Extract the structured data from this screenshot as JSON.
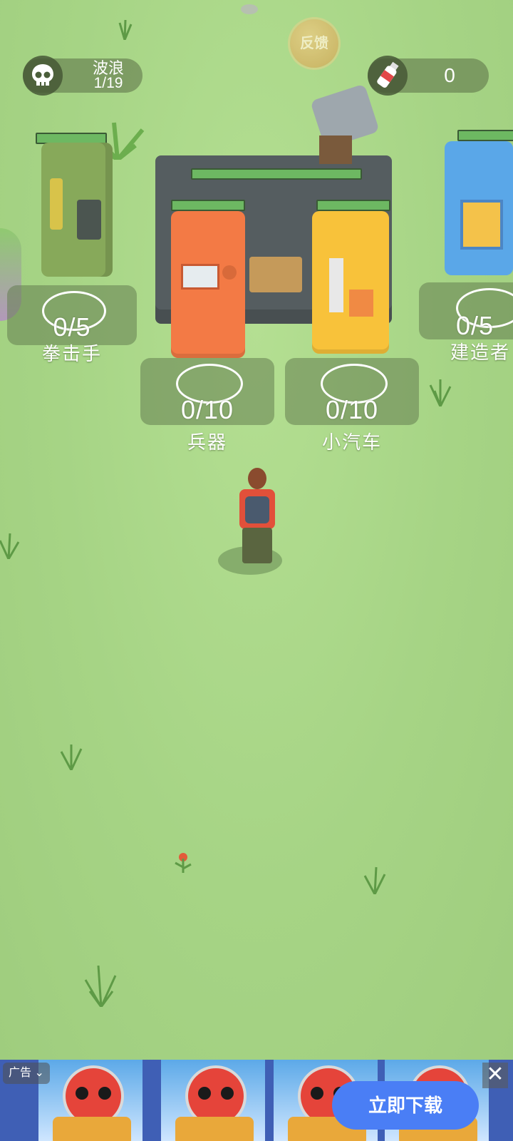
{
  "hud": {
    "wave_label": "波浪",
    "wave_count": "1/19",
    "bottle_count": "0",
    "feedback_label": "反馈"
  },
  "stations": [
    {
      "id": "boxer",
      "progress": "0/5",
      "label": "拳击手",
      "icon": "fist-icon"
    },
    {
      "id": "weapon",
      "progress": "0/10",
      "label": "兵器",
      "icon": "rifle-icon"
    },
    {
      "id": "car",
      "progress": "0/10",
      "label": "小汽车",
      "icon": "car-icon"
    },
    {
      "id": "builder",
      "progress": "0/5",
      "label": "建造者",
      "icon": "hammer-icon"
    }
  ],
  "ad": {
    "tag": "广告",
    "download_label": "立即下载",
    "close_label": "✕"
  },
  "colors": {
    "ground": "#a9d98a",
    "orange_machine": "#f37a45",
    "yellow_machine": "#f8c23a",
    "green_machine": "#87a95a",
    "blue_machine": "#5aa7e8",
    "download_button": "#4a7ef5"
  }
}
